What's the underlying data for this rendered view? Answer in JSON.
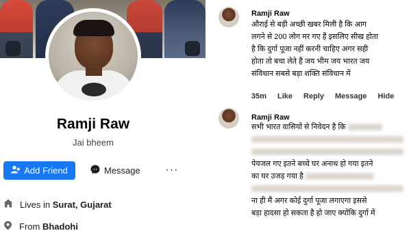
{
  "profile": {
    "name": "Ramji Raw",
    "bio": "Jai bheem",
    "add_friend_label": "Add Friend",
    "message_label": "Message",
    "more_label": "···",
    "lives_in_prefix": "Lives in",
    "lives_in_place": "Surat, Gujarat",
    "from_prefix": "From",
    "from_place": "Bhadohi"
  },
  "comments": [
    {
      "author": "Ramji Raw",
      "lines": [
        "औराई से बड़ी अच्छी खबर मिली है कि आग",
        "लगने से 200 लोग मर गए हैं इसलिए सीख होता",
        "है कि दुर्गा पूजा नहीं करनी चाहिए अगर सही",
        "होता तो बचा लेते हैं जय भीम जय भारत जय",
        "संविधान सबसे बड़ा शक्ति संविधान में"
      ],
      "actions": {
        "time": "35m",
        "like": "Like",
        "reply": "Reply",
        "message": "Message",
        "hide": "Hide"
      }
    },
    {
      "author": "Ramji Raw",
      "line1": "सभी भारत वासियों से निवेदन है कि",
      "line4": "पेयजल गए इतने बच्चे घर अनाथ हो गया इतने",
      "line5": "का घर उजड़ गया है",
      "line7": "ना ही मैं अगर कोई दुर्गा पूजा लगाएगा इससे",
      "line8": "बड़ा हादसा हो सकता है हो जाए क्योंकि दुर्गा में"
    }
  ],
  "colors": {
    "accent": "#1877f2",
    "text": "#050505"
  }
}
